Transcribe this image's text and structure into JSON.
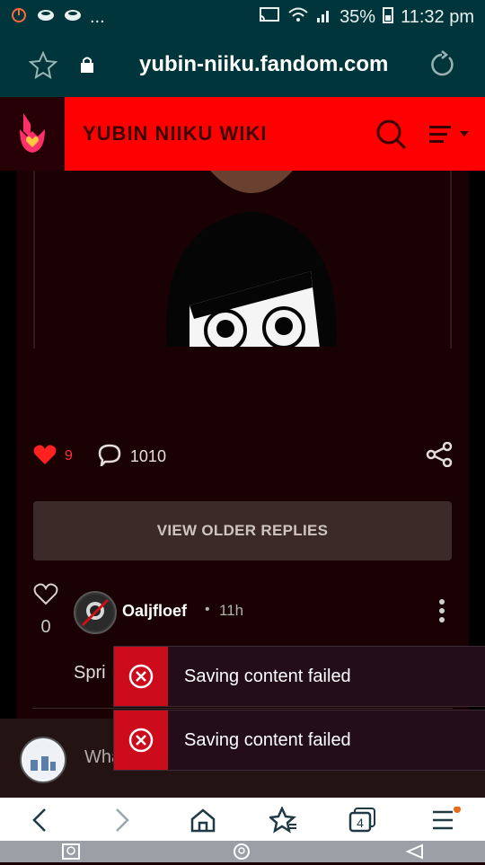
{
  "status_bar": {
    "notif_dots": "...",
    "battery": "35%",
    "time": "11:32 pm"
  },
  "browser": {
    "url": "yubin-niiku.fandom.com"
  },
  "wiki": {
    "title": "YUBIN NIIKU WIKI"
  },
  "post": {
    "like_count": "9",
    "comment_count": "1010"
  },
  "view_older_replies": "VIEW OLDER REPLIES",
  "reply": {
    "likes": "0",
    "author": "Oaljfloef",
    "separator": "•",
    "time": "11h",
    "text_partial": "Spri"
  },
  "compose": {
    "placeholder_partial": "Wha"
  },
  "toasts": [
    {
      "message": "Saving content failed"
    },
    {
      "message": "Saving content failed"
    }
  ],
  "bottom_nav": {
    "tab_count": "4"
  },
  "colors": {
    "wiki_red": "#ff0000",
    "toast_red": "#cc0c1c",
    "browser_teal": "#00363b",
    "page_bg": "#1a0204"
  }
}
